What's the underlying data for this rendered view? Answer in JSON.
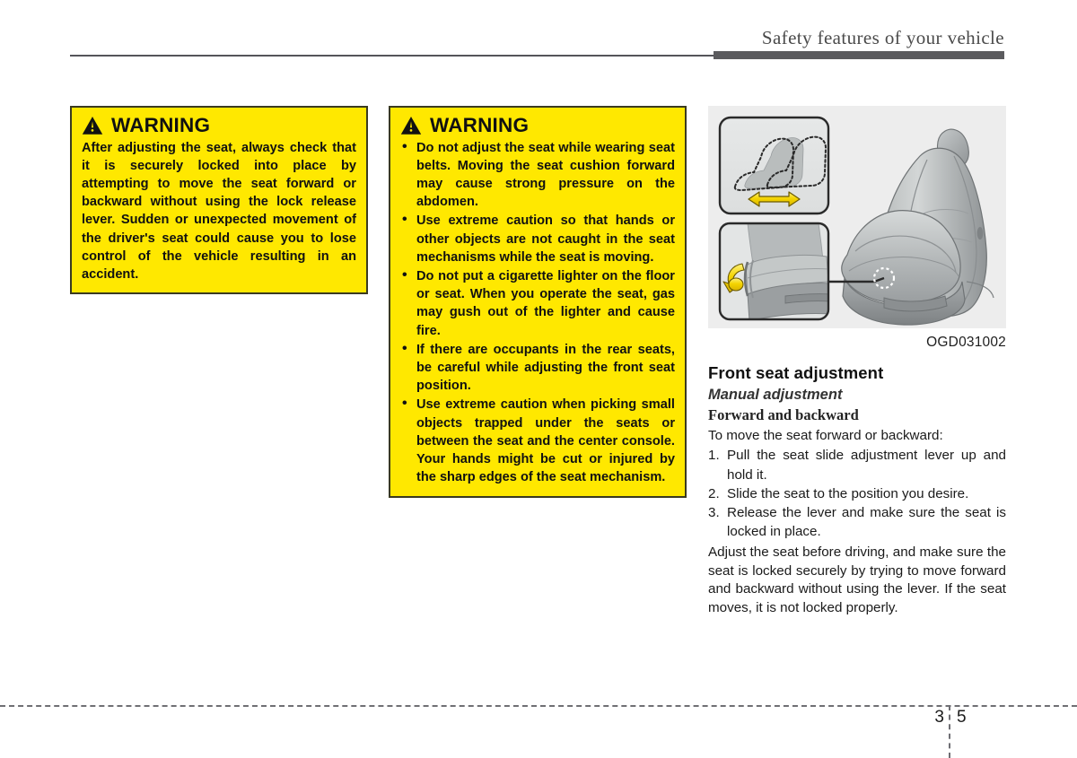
{
  "header": {
    "title": "Safety features of your vehicle"
  },
  "warning_left": {
    "icon": "warning-triangle-icon",
    "title": "WARNING",
    "body": "After adjusting the seat, always check that it is securely locked into place by attempting to move the seat forward or backward without using the lock release lever. Sudden or unexpected movement of the driver's seat could cause you to lose control of the vehicle resulting in an accident."
  },
  "warning_middle": {
    "icon": "warning-triangle-icon",
    "title": "WARNING",
    "bullets": [
      "Do not adjust the seat while wearing seat belts. Moving the seat cushion forward may cause strong pressure on the abdomen.",
      "Use extreme caution so that hands or other objects are not caught in the seat mechanisms while the seat is moving.",
      "Do not put a cigarette lighter on the floor or seat. When you operate the seat, gas may gush out of the lighter and cause fire.",
      "If there are occupants in the rear seats, be careful while adjusting the front seat position.",
      "Use extreme caution when picking small objects trapped under the seats or between the seat and the center console. Your hands might be cut or injured by the sharp edges of the seat mechanism."
    ]
  },
  "illustration": {
    "alt": "front-seat-with-slide-adjustment-lever-diagram",
    "inset_top": "seat-slide-direction-inset",
    "inset_bottom": "seat-lever-pull-up-inset",
    "figure_code": "OGD031002",
    "arrow_color": "#f2d600",
    "background": "#ededed"
  },
  "right_column": {
    "section_heading": "Front seat adjustment",
    "sub_heading": "Manual adjustment",
    "sub_sub_heading": "Forward and backward",
    "intro": "To move the seat forward or backward:",
    "steps": [
      {
        "num": "1.",
        "text": "Pull the seat slide adjustment lever up and hold it."
      },
      {
        "num": "2.",
        "text": "Slide the seat to the position you desire."
      },
      {
        "num": "3.",
        "text": "Release the lever and make sure the seat is locked in place."
      }
    ],
    "closing": "Adjust the seat before driving, and make sure the seat is locked securely by trying to move forward and backward without using the lever. If the seat moves, it is not locked properly."
  },
  "footer": {
    "chapter": "3",
    "page": "5"
  }
}
